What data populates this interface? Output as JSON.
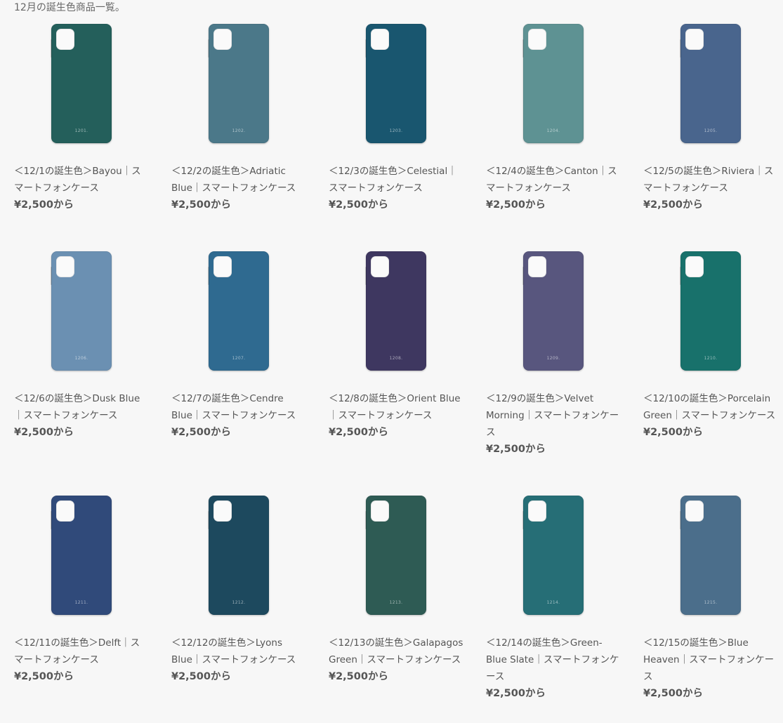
{
  "page": {
    "heading": "12月の誕生色商品一覧。"
  },
  "products": [
    {
      "title": "＜12/1の誕生色＞Bayou｜スマートフォンケース",
      "price": "¥2,500から",
      "code": "1201.",
      "color": "#245f5b"
    },
    {
      "title": "＜12/2の誕生色＞Adriatic Blue｜スマートフォンケース",
      "price": "¥2,500から",
      "code": "1202.",
      "color": "#4b7889"
    },
    {
      "title": "＜12/3の誕生色＞Celestial｜スマートフォンケース",
      "price": "¥2,500から",
      "code": "1203.",
      "color": "#19566f"
    },
    {
      "title": "＜12/4の誕生色＞Canton｜スマートフォンケース",
      "price": "¥2,500から",
      "code": "1204.",
      "color": "#5e9293"
    },
    {
      "title": "＜12/5の誕生色＞Riviera｜スマートフォンケース",
      "price": "¥2,500から",
      "code": "1205.",
      "color": "#49658d"
    },
    {
      "title": "＜12/6の誕生色＞Dusk Blue｜スマートフォンケース",
      "price": "¥2,500から",
      "code": "1206.",
      "color": "#6b90b2"
    },
    {
      "title": "＜12/7の誕生色＞Cendre Blue｜スマートフォンケース",
      "price": "¥2,500から",
      "code": "1207.",
      "color": "#2f6a90"
    },
    {
      "title": "＜12/8の誕生色＞Orient Blue｜スマートフォンケース",
      "price": "¥2,500から",
      "code": "1208.",
      "color": "#3e3760"
    },
    {
      "title": "＜12/9の誕生色＞Velvet Morning｜スマートフォンケース",
      "price": "¥2,500から",
      "code": "1209.",
      "color": "#58567e"
    },
    {
      "title": "＜12/10の誕生色＞Porcelain Green｜スマートフォンケース",
      "price": "¥2,500から",
      "code": "1210.",
      "color": "#18716b"
    },
    {
      "title": "＜12/11の誕生色＞Delft｜スマートフォンケース",
      "price": "¥2,500から",
      "code": "1211.",
      "color": "#304a7a"
    },
    {
      "title": "＜12/12の誕生色＞Lyons Blue｜スマートフォンケース",
      "price": "¥2,500から",
      "code": "1212.",
      "color": "#1d495e"
    },
    {
      "title": "＜12/13の誕生色＞Galapagos Green｜スマートフォンケース",
      "price": "¥2,500から",
      "code": "1213.",
      "color": "#2e5b54"
    },
    {
      "title": "＜12/14の誕生色＞Green-Blue Slate｜スマートフォンケース",
      "price": "¥2,500から",
      "code": "1214.",
      "color": "#266e76"
    },
    {
      "title": "＜12/15の誕生色＞Blue Heaven｜スマートフォンケース",
      "price": "¥2,500から",
      "code": "1215.",
      "color": "#4b6e8b"
    }
  ]
}
